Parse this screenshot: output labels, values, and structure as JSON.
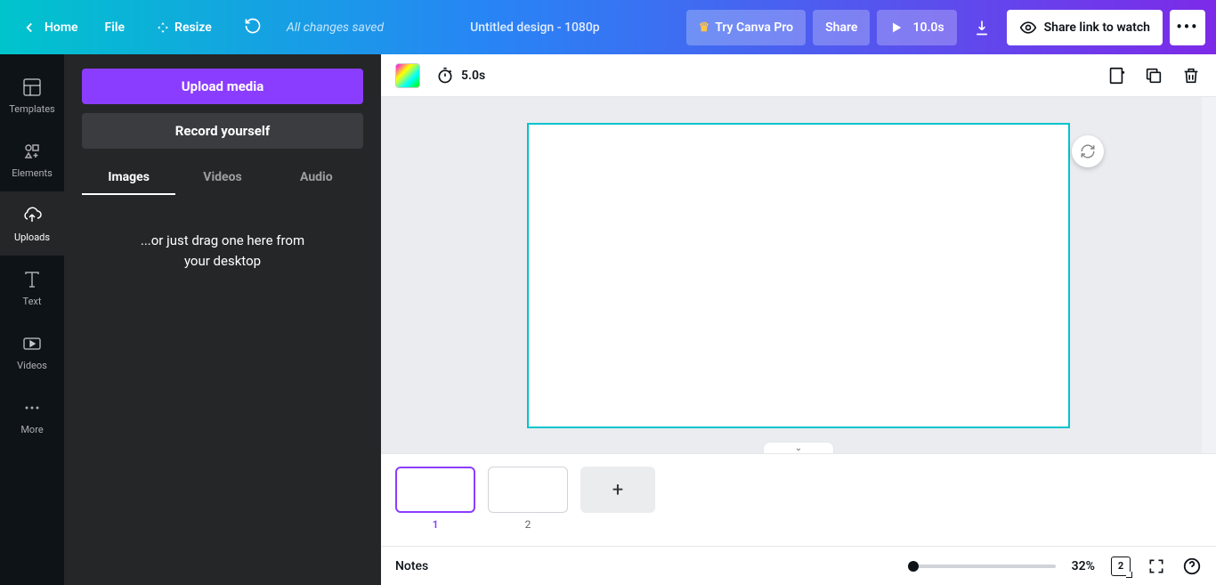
{
  "topbar": {
    "home": "Home",
    "file": "File",
    "resize": "Resize",
    "saved": "All changes saved",
    "title": "Untitled design - 1080p",
    "try_pro": "Try Canva Pro",
    "share": "Share",
    "play_duration": "10.0s",
    "share_watch": "Share link to watch"
  },
  "rail": {
    "templates": "Templates",
    "elements": "Elements",
    "uploads": "Uploads",
    "text": "Text",
    "videos": "Videos",
    "more": "More"
  },
  "panel": {
    "upload": "Upload media",
    "record": "Record yourself",
    "tabs": {
      "images": "Images",
      "videos": "Videos",
      "audio": "Audio"
    },
    "drag1": "...or just drag one here from",
    "drag2": "your desktop"
  },
  "canvas": {
    "duration": "5.0s"
  },
  "pages": {
    "labels": [
      "1",
      "2"
    ]
  },
  "footer": {
    "notes": "Notes",
    "zoom": "32%",
    "page_count": "2"
  }
}
